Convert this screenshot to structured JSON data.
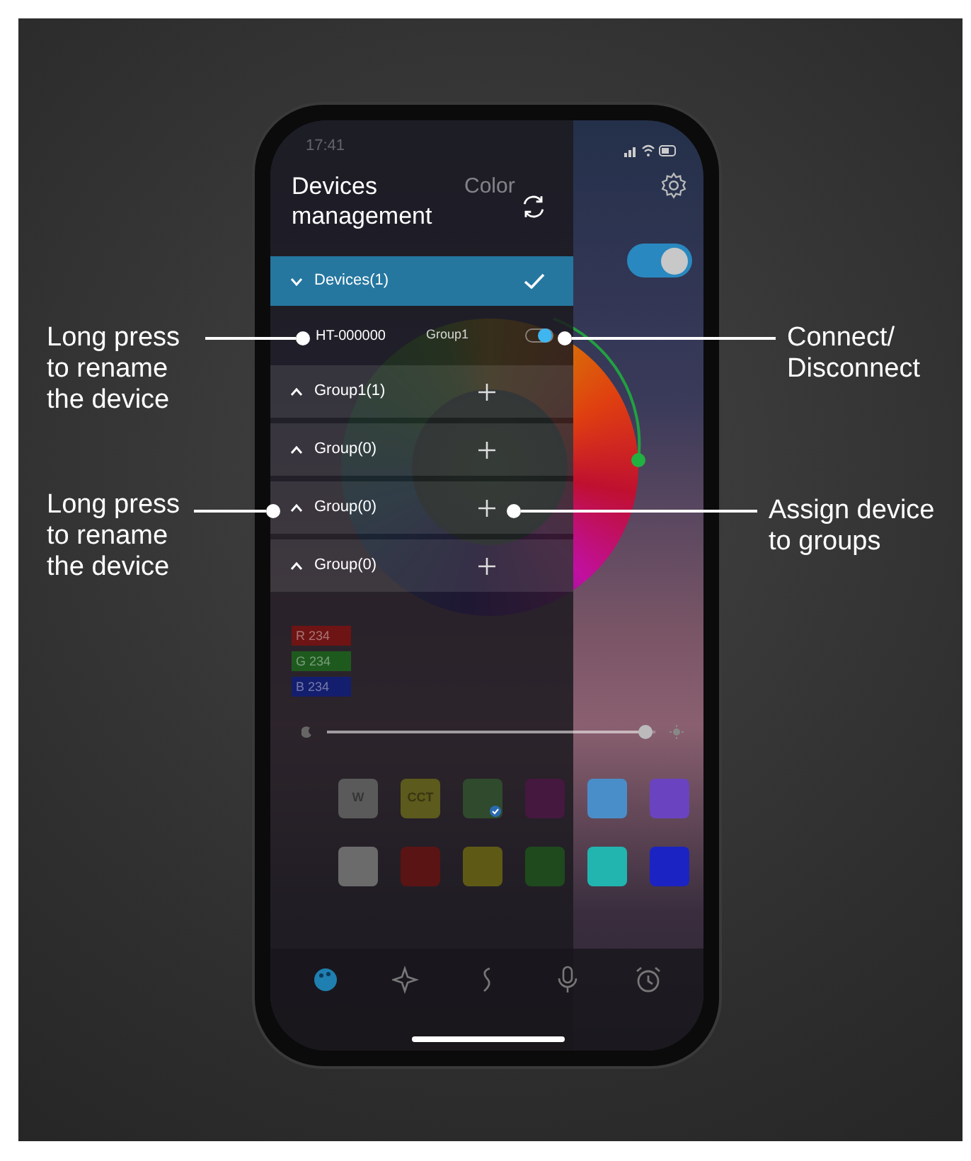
{
  "status_bar": {
    "time": "17:41"
  },
  "header": {
    "title": "Devices management",
    "tab": "Color"
  },
  "power_switch": {
    "on": true
  },
  "devices_header": {
    "label": "Devices(1)",
    "expanded": true
  },
  "device": {
    "name": "HT-000000",
    "group": "Group1",
    "connected": true
  },
  "groups": [
    {
      "label": "Group1(1)",
      "expanded": false
    },
    {
      "label": "Group(0)",
      "expanded": false
    },
    {
      "label": "Group(0)",
      "expanded": false
    },
    {
      "label": "Group(0)",
      "expanded": false
    }
  ],
  "rgb": [
    {
      "text": "R 234",
      "color": "#6e1414"
    },
    {
      "text": "G 234",
      "color": "#1e5a1e"
    },
    {
      "text": "B 234",
      "color": "#141e6e"
    }
  ],
  "brightness": {
    "level": 0.97
  },
  "swatches": [
    [
      {
        "color": "#5a5a5a",
        "label": "W",
        "selected": false
      },
      {
        "color": "#5c5a1c",
        "label": "CCT",
        "selected": false
      },
      {
        "color": "#2f4a2c",
        "selected": true
      },
      {
        "color": "#45183f",
        "selected": false
      },
      {
        "color": "#4a8ec9",
        "selected": false
      },
      {
        "color": "#6a44c0",
        "selected": false
      }
    ],
    [
      {
        "color": "#6b6b6b",
        "selected": false
      },
      {
        "color": "#5a1414",
        "selected": false
      },
      {
        "color": "#5e5a16",
        "selected": false
      },
      {
        "color": "#1e4a1e",
        "selected": false
      },
      {
        "color": "#22b5b0",
        "selected": false
      },
      {
        "color": "#1b24c2",
        "selected": false
      }
    ]
  ],
  "nav": [
    {
      "kind": "palette",
      "selected": true
    },
    {
      "kind": "sparkle",
      "selected": false
    },
    {
      "kind": "music",
      "selected": false
    },
    {
      "kind": "mic",
      "selected": false
    },
    {
      "kind": "alarm",
      "selected": false
    }
  ],
  "callouts": [
    {
      "lines": [
        "Long press",
        "to rename",
        "the device"
      ]
    },
    {
      "lines": [
        "Connect/",
        "Disconnect"
      ]
    },
    {
      "lines": [
        "Long press",
        "to rename",
        "the device"
      ]
    },
    {
      "lines": [
        "Assign device",
        "to groups"
      ]
    }
  ]
}
